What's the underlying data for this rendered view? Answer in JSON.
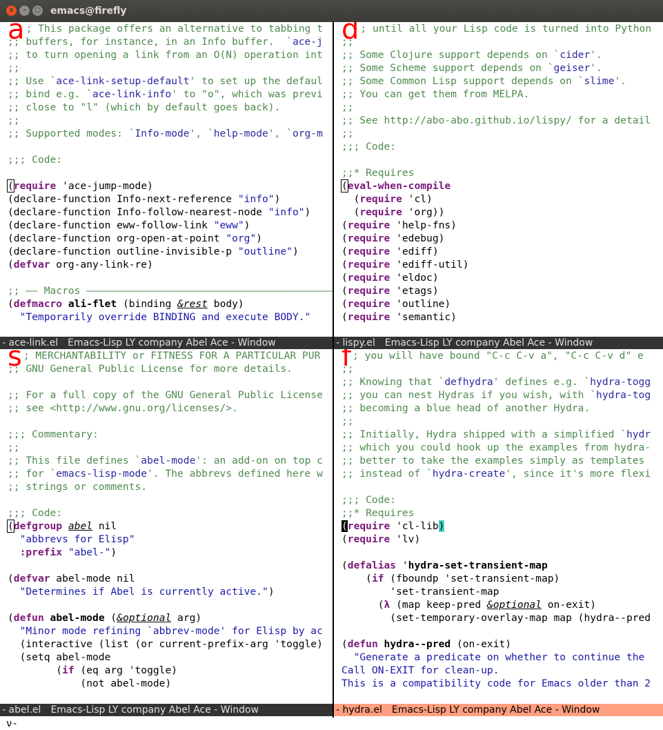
{
  "window_title": "emacs@firefly",
  "window_buttons": {
    "close": "x",
    "minimize": "-",
    "maximize": "□"
  },
  "windows": [
    {
      "label": "a",
      "modeline": {
        "buffer": "- ace-link.el",
        "info": "Emacs-Lisp LY company Abel Ace - Window"
      },
      "active": false,
      "lines": [
        [
          [
            "c",
            "; This package offers an alternative to tabbing t"
          ]
        ],
        [
          [
            "c",
            ";; buffers, for instance, in an Info buffer.  `"
          ],
          [
            "r",
            "ace-j"
          ]
        ],
        [
          [
            "c",
            ";; to turn opening a link from an O(N) operation int"
          ]
        ],
        [
          [
            "c",
            ";;"
          ]
        ],
        [
          [
            "c",
            ";; Use `"
          ],
          [
            "r",
            "ace-link-setup-default"
          ],
          [
            "c",
            "' to set up the defaul"
          ]
        ],
        [
          [
            "c",
            ";; bind e.g. `"
          ],
          [
            "r",
            "ace-link-info"
          ],
          [
            "c",
            "' to \"o\", which was previ"
          ]
        ],
        [
          [
            "c",
            ";; close to \"l\" (which by default goes back)."
          ]
        ],
        [
          [
            "c",
            ";;"
          ]
        ],
        [
          [
            "c",
            ";; Supported modes: `"
          ],
          [
            "r",
            "Info-mode"
          ],
          [
            "c",
            "', `"
          ],
          [
            "r",
            "help-mode"
          ],
          [
            "c",
            "', `"
          ],
          [
            "r",
            "org-m"
          ]
        ],
        [
          [
            "t",
            ""
          ]
        ],
        [
          [
            "c",
            ";;; Code:"
          ]
        ],
        [
          [
            "t",
            ""
          ]
        ],
        [
          [
            "cur",
            "("
          ],
          [
            "k",
            "require"
          ],
          [
            "t",
            " 'ace-jump-mode)"
          ]
        ],
        [
          [
            "t",
            "(declare-function Info-next-reference "
          ],
          [
            "s",
            "\"info\""
          ],
          [
            "t",
            ")"
          ]
        ],
        [
          [
            "t",
            "(declare-function Info-follow-nearest-node "
          ],
          [
            "s",
            "\"info\""
          ],
          [
            "t",
            ")"
          ]
        ],
        [
          [
            "t",
            "(declare-function eww-follow-link "
          ],
          [
            "s",
            "\"eww\""
          ],
          [
            "t",
            ")"
          ]
        ],
        [
          [
            "t",
            "(declare-function org-open-at-point "
          ],
          [
            "s",
            "\"org\""
          ],
          [
            "t",
            ")"
          ]
        ],
        [
          [
            "t",
            "(declare-function outline-invisible-p "
          ],
          [
            "s",
            "\"outline\""
          ],
          [
            "t",
            ")"
          ]
        ],
        [
          [
            "t",
            "("
          ],
          [
            "k",
            "defvar"
          ],
          [
            "t",
            " org-any-link-re)"
          ]
        ],
        [
          [
            "t",
            ""
          ]
        ],
        [
          [
            "c",
            ";; —— Macros ——————————————————————————————————————————"
          ]
        ],
        [
          [
            "t",
            "("
          ],
          [
            "k",
            "defmacro"
          ],
          [
            "t",
            " "
          ],
          [
            "f",
            "ali-flet"
          ],
          [
            "t",
            " (binding "
          ],
          [
            "i",
            "&rest"
          ],
          [
            "t",
            " body)"
          ]
        ],
        [
          [
            "s",
            "  \"Temporarily override BINDING and execute BODY.\""
          ]
        ]
      ]
    },
    {
      "label": "d",
      "modeline": {
        "buffer": "- lispy.el",
        "info": "Emacs-Lisp LY company Abel Ace - Window"
      },
      "active": false,
      "lines": [
        [
          [
            "c",
            "; until all your Lisp code is turned into Python"
          ]
        ],
        [
          [
            "c",
            ";;"
          ]
        ],
        [
          [
            "c",
            ";; Some Clojure support depends on `"
          ],
          [
            "r",
            "cider"
          ],
          [
            "c",
            "'."
          ]
        ],
        [
          [
            "c",
            ";; Some Scheme support depends on `"
          ],
          [
            "r",
            "geiser"
          ],
          [
            "c",
            "'."
          ]
        ],
        [
          [
            "c",
            ";; Some Common Lisp support depends on `"
          ],
          [
            "r",
            "slime"
          ],
          [
            "c",
            "'."
          ]
        ],
        [
          [
            "c",
            ";; You can get them from MELPA."
          ]
        ],
        [
          [
            "c",
            ";;"
          ]
        ],
        [
          [
            "c",
            ";; See http://abo-abo.github.io/lispy/ for a detail"
          ]
        ],
        [
          [
            "c",
            ";;"
          ]
        ],
        [
          [
            "c",
            ";;; Code:"
          ]
        ],
        [
          [
            "t",
            ""
          ]
        ],
        [
          [
            "c",
            ";;* Requires"
          ]
        ],
        [
          [
            "cur",
            "("
          ],
          [
            "k",
            "eval-when-compile"
          ]
        ],
        [
          [
            "t",
            "  ("
          ],
          [
            "k",
            "require"
          ],
          [
            "t",
            " 'cl)"
          ]
        ],
        [
          [
            "t",
            "  ("
          ],
          [
            "k",
            "require"
          ],
          [
            "t",
            " 'org))"
          ]
        ],
        [
          [
            "t",
            "("
          ],
          [
            "k",
            "require"
          ],
          [
            "t",
            " 'help-fns)"
          ]
        ],
        [
          [
            "t",
            "("
          ],
          [
            "k",
            "require"
          ],
          [
            "t",
            " 'edebug)"
          ]
        ],
        [
          [
            "t",
            "("
          ],
          [
            "k",
            "require"
          ],
          [
            "t",
            " 'ediff)"
          ]
        ],
        [
          [
            "t",
            "("
          ],
          [
            "k",
            "require"
          ],
          [
            "t",
            " 'ediff-util)"
          ]
        ],
        [
          [
            "t",
            "("
          ],
          [
            "k",
            "require"
          ],
          [
            "t",
            " 'eldoc)"
          ]
        ],
        [
          [
            "t",
            "("
          ],
          [
            "k",
            "require"
          ],
          [
            "t",
            " 'etags)"
          ]
        ],
        [
          [
            "t",
            "("
          ],
          [
            "k",
            "require"
          ],
          [
            "t",
            " 'outline)"
          ]
        ],
        [
          [
            "t",
            "("
          ],
          [
            "k",
            "require"
          ],
          [
            "t",
            " 'semantic)"
          ]
        ]
      ]
    },
    {
      "label": "s",
      "modeline": {
        "buffer": "- abel.el",
        "info": "Emacs-Lisp LY company Abel Ace - Window"
      },
      "active": false,
      "lines": [
        [
          [
            "c",
            "; MERCHANTABILITY or FITNESS FOR A PARTICULAR PUR"
          ]
        ],
        [
          [
            "c",
            ";; GNU General Public License for more details."
          ]
        ],
        [
          [
            "t",
            ""
          ]
        ],
        [
          [
            "c",
            ";; For a full copy of the GNU General Public License"
          ]
        ],
        [
          [
            "c",
            ";; see <http://www.gnu.org/licenses/>."
          ]
        ],
        [
          [
            "t",
            ""
          ]
        ],
        [
          [
            "c",
            ";;; Commentary:"
          ]
        ],
        [
          [
            "c",
            ";;"
          ]
        ],
        [
          [
            "c",
            ";; This file defines `"
          ],
          [
            "r",
            "abel-mode"
          ],
          [
            "c",
            "': an add-on on top c"
          ]
        ],
        [
          [
            "c",
            ";; for `"
          ],
          [
            "r",
            "emacs-lisp-mode"
          ],
          [
            "c",
            "'. The abbrevs defined here w"
          ]
        ],
        [
          [
            "c",
            ";; strings or comments."
          ]
        ],
        [
          [
            "t",
            ""
          ]
        ],
        [
          [
            "c",
            ";;; Code:"
          ]
        ],
        [
          [
            "cur",
            "("
          ],
          [
            "k",
            "defgroup"
          ],
          [
            "t",
            " "
          ],
          [
            "i",
            "abel"
          ],
          [
            "t",
            " nil"
          ]
        ],
        [
          [
            "s",
            "  \"abbrevs for Elisp\""
          ]
        ],
        [
          [
            "t",
            "  "
          ],
          [
            "k",
            ":prefix"
          ],
          [
            "t",
            " "
          ],
          [
            "s",
            "\"abel-\""
          ],
          [
            "t",
            ")"
          ]
        ],
        [
          [
            "t",
            ""
          ]
        ],
        [
          [
            "t",
            "("
          ],
          [
            "k",
            "defvar"
          ],
          [
            "t",
            " abel-mode nil"
          ]
        ],
        [
          [
            "s",
            "  \"Determines if Abel is currently active.\""
          ],
          [
            "t",
            ")"
          ]
        ],
        [
          [
            "t",
            ""
          ]
        ],
        [
          [
            "t",
            "("
          ],
          [
            "k",
            "defun"
          ],
          [
            "t",
            " "
          ],
          [
            "f",
            "abel-mode"
          ],
          [
            "t",
            " ("
          ],
          [
            "i",
            "&optional"
          ],
          [
            "t",
            " arg)"
          ]
        ],
        [
          [
            "s",
            "  \"Minor mode refining `abbrev-mode' for Elisp by ac"
          ]
        ],
        [
          [
            "t",
            "  (interactive (list (or current-prefix-arg 'toggle)"
          ]
        ],
        [
          [
            "t",
            "  (setq abel-mode"
          ]
        ],
        [
          [
            "t",
            "        ("
          ],
          [
            "k",
            "if"
          ],
          [
            "t",
            " (eq arg 'toggle)"
          ]
        ],
        [
          [
            "t",
            "            (not abel-mode)"
          ]
        ]
      ]
    },
    {
      "label": "f",
      "modeline": {
        "buffer": "- hydra.el",
        "info": "Emacs-Lisp LY company Abel Ace - Window"
      },
      "active": true,
      "lines": [
        [
          [
            "c",
            "; you will have bound \"C-c C-v a\", \"C-c C-v d\" e"
          ]
        ],
        [
          [
            "c",
            ";;"
          ]
        ],
        [
          [
            "c",
            ";; Knowing that `"
          ],
          [
            "r",
            "defhydra"
          ],
          [
            "c",
            "' defines e.g. `"
          ],
          [
            "r",
            "hydra-togg"
          ]
        ],
        [
          [
            "c",
            ";; you can nest Hydras if you wish, with `"
          ],
          [
            "r",
            "hydra-tog"
          ]
        ],
        [
          [
            "c",
            ";; becoming a blue head of another Hydra."
          ]
        ],
        [
          [
            "c",
            ";;"
          ]
        ],
        [
          [
            "c",
            ";; Initially, Hydra shipped with a simplified `"
          ],
          [
            "r",
            "hydr"
          ]
        ],
        [
          [
            "c",
            ";; which you could hook up the examples from hydra-"
          ]
        ],
        [
          [
            "c",
            ";; better to take the examples simply as templates "
          ]
        ],
        [
          [
            "c",
            ";; instead of `"
          ],
          [
            "r",
            "hydra-create"
          ],
          [
            "c",
            "', since it's more flexi"
          ]
        ],
        [
          [
            "t",
            ""
          ]
        ],
        [
          [
            "c",
            ";;; Code:"
          ]
        ],
        [
          [
            "c",
            ";;* Requires"
          ]
        ],
        [
          [
            "ca",
            "("
          ],
          [
            "k",
            "require"
          ],
          [
            "t",
            " 'cl-lib"
          ],
          [
            "hp",
            ")"
          ]
        ],
        [
          [
            "t",
            "("
          ],
          [
            "k",
            "require"
          ],
          [
            "t",
            " 'lv)"
          ]
        ],
        [
          [
            "t",
            ""
          ]
        ],
        [
          [
            "t",
            "("
          ],
          [
            "k",
            "defalias"
          ],
          [
            "t",
            " '"
          ],
          [
            "f",
            "hydra-set-transient-map"
          ]
        ],
        [
          [
            "t",
            "    ("
          ],
          [
            "k",
            "if"
          ],
          [
            "t",
            " (fboundp 'set-transient-map)"
          ]
        ],
        [
          [
            "t",
            "        'set-transient-map"
          ]
        ],
        [
          [
            "t",
            "      ("
          ],
          [
            "k",
            "λ"
          ],
          [
            "t",
            " (map keep-pred "
          ],
          [
            "i",
            "&optional"
          ],
          [
            "t",
            " on-exit)"
          ]
        ],
        [
          [
            "t",
            "        (set-temporary-overlay-map map (hydra--pred"
          ]
        ],
        [
          [
            "t",
            ""
          ]
        ],
        [
          [
            "t",
            "("
          ],
          [
            "k",
            "defun"
          ],
          [
            "t",
            " "
          ],
          [
            "f",
            "hydra--pred"
          ],
          [
            "t",
            " (on-exit)"
          ]
        ],
        [
          [
            "s",
            "  \"Generate a predicate on whether to continue the "
          ]
        ],
        [
          [
            "s",
            "Call ON-EXIT for clean-up."
          ]
        ],
        [
          [
            "s",
            "This is a compatibility code for Emacs older than 2"
          ]
        ]
      ]
    }
  ],
  "minibuffer": "ν-"
}
